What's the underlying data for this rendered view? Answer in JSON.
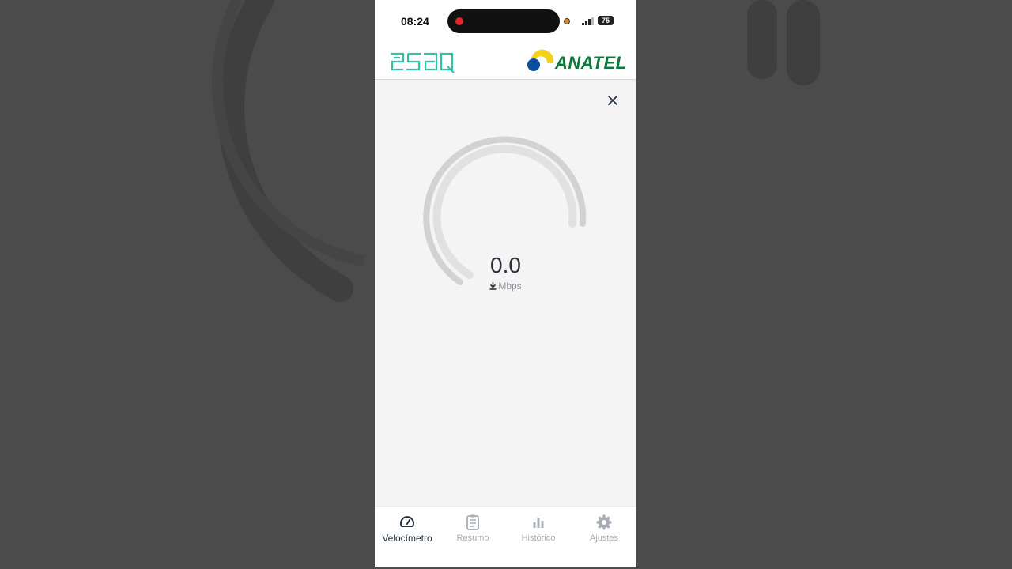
{
  "status_bar": {
    "time": "08:24",
    "battery": "75"
  },
  "header": {
    "left_logo_text": "esaq",
    "right_logo_text": "ANATEL"
  },
  "speed": {
    "value": "0.0",
    "unit": "Mbps",
    "gauge_level": 0
  },
  "tabs": [
    {
      "label": "Velocímetro",
      "icon": "speedometer-icon",
      "active": true
    },
    {
      "label": "Resumo",
      "icon": "clipboard-icon",
      "active": false
    },
    {
      "label": "Histórico",
      "icon": "bar-chart-icon",
      "active": false
    },
    {
      "label": "Ajustes",
      "icon": "gear-icon",
      "active": false
    }
  ],
  "colors": {
    "accent_dark": "#243041",
    "inactive": "#a8adb5",
    "esaq_teal": "#2ec4a4",
    "anatel_green": "#0a7a3a",
    "anatel_yellow": "#f2d21b",
    "anatel_blue": "#0b4f9c",
    "gauge_track": "#d2d2d2"
  }
}
